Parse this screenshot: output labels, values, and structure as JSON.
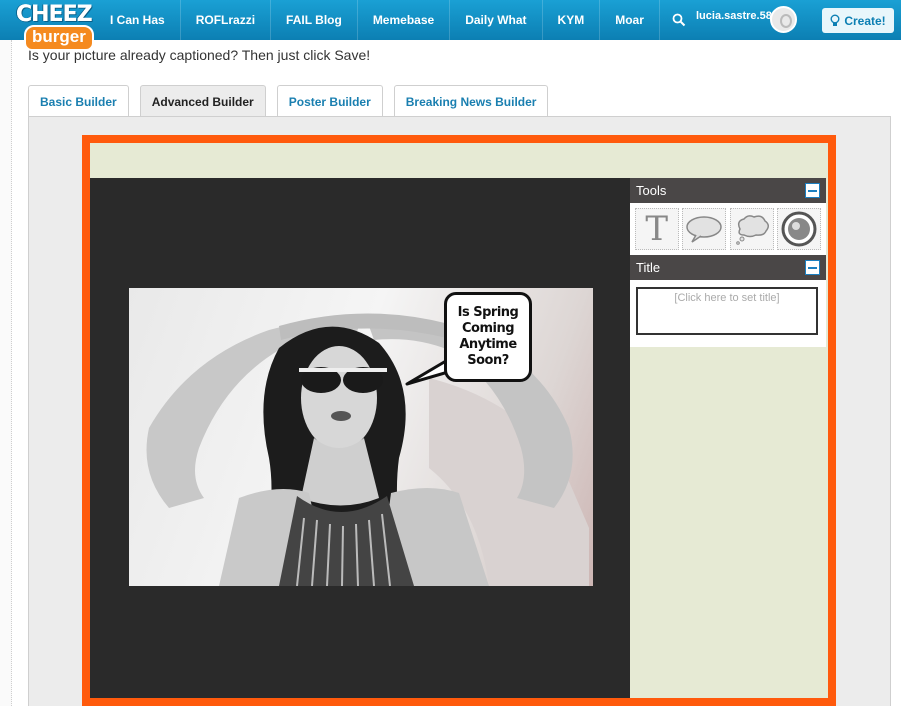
{
  "brand": {
    "line1": "CHEEZ",
    "line2": "burger"
  },
  "nav": [
    "I Can Has",
    "ROFLrazzi",
    "FAIL Blog",
    "Memebase",
    "Daily What",
    "KYM",
    "Moar"
  ],
  "user": {
    "name": "lucia.sastre.58"
  },
  "create_label": "Create!",
  "intro_text": "Is your picture already captioned? Then just click Save!",
  "tabs": [
    {
      "label": "Basic Builder"
    },
    {
      "label": "Advanced Builder"
    },
    {
      "label": "Poster Builder"
    },
    {
      "label": "Breaking News Builder"
    }
  ],
  "caption": "Is Spring Coming Anytime Soon?",
  "tools": {
    "title": "Tools",
    "text_tool": "T"
  },
  "title_panel": {
    "heading": "Title",
    "placeholder": "[Click here to set title]"
  }
}
